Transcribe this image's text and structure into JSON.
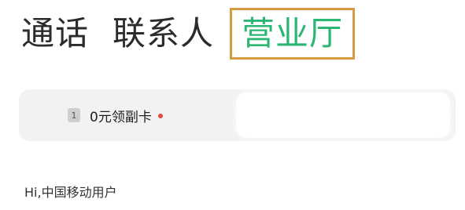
{
  "tabs": {
    "calls": "通话",
    "contacts": "联系人",
    "business_hall": "营业厅"
  },
  "promo": {
    "sim_index": "1",
    "label": "0元领副卡"
  },
  "greeting": "Hi,中国移动用户",
  "colors": {
    "active_tab": "#2bb673",
    "highlight_border": "#d79a45",
    "notification_dot": "#e24a3a"
  }
}
